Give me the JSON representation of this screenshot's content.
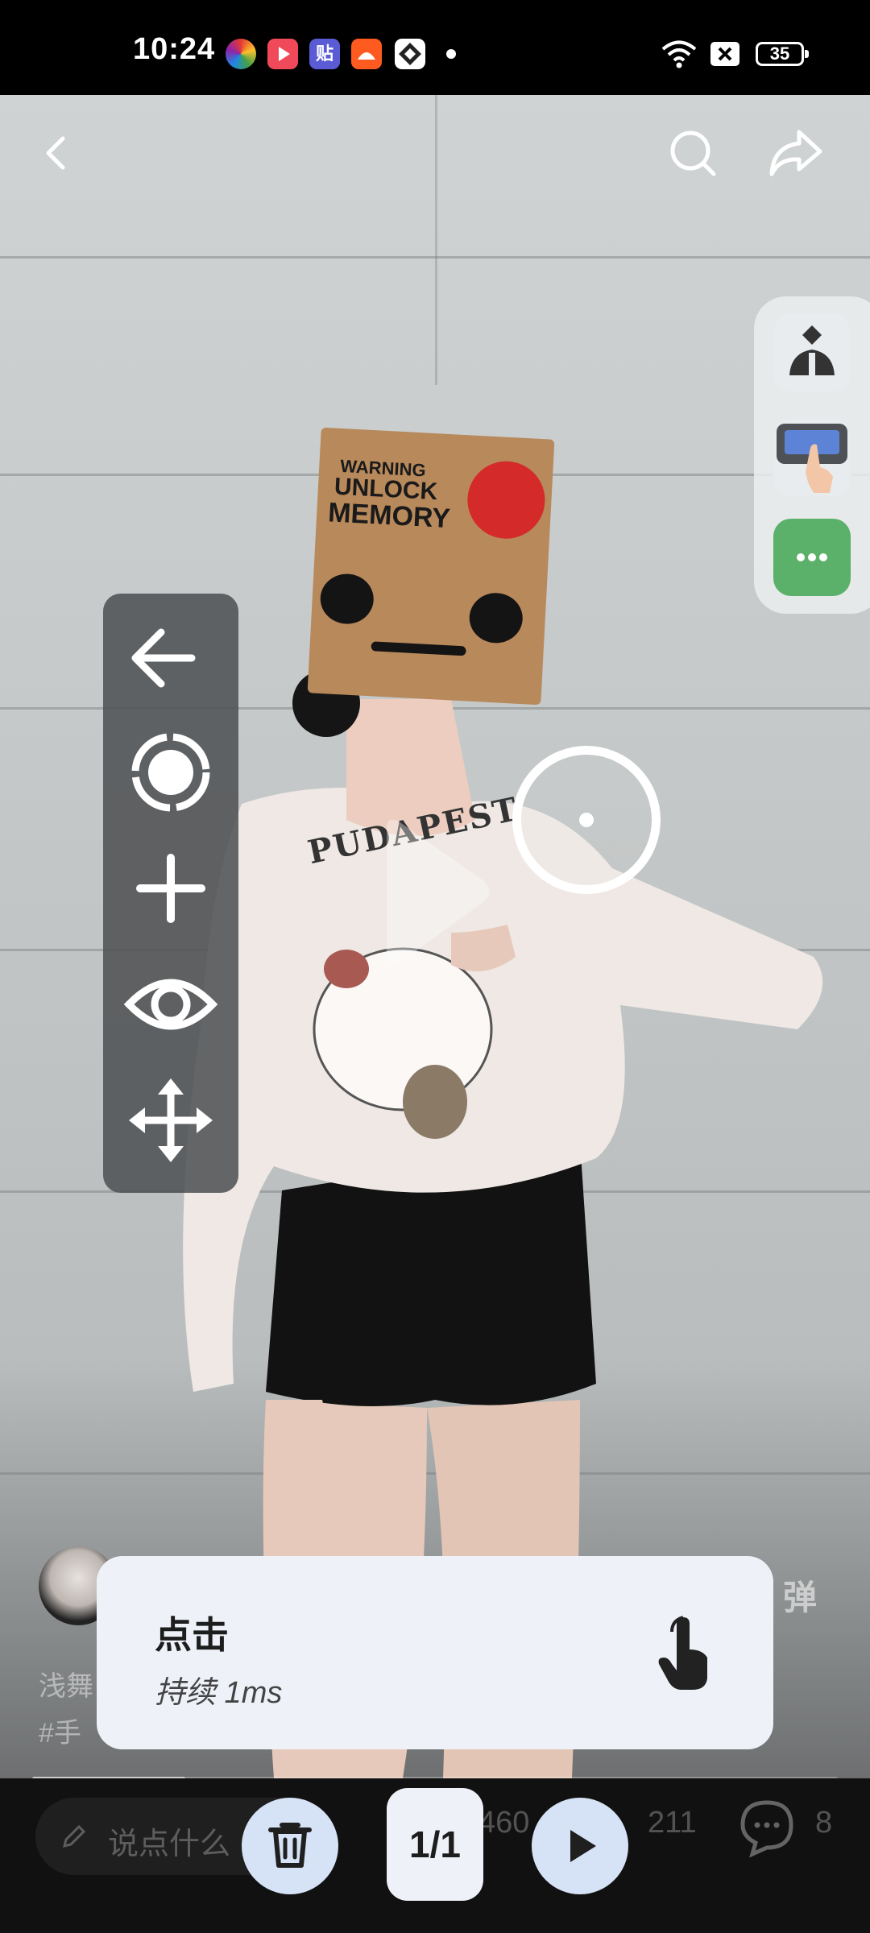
{
  "status_bar": {
    "time": "10:24",
    "battery": "35",
    "app_icons": [
      "colorful-app-icon",
      "video-app-icon",
      "tieba-app-icon",
      "taobao-app-icon",
      "puzzle-app-icon"
    ],
    "icons": [
      "wifi-icon",
      "x-box-icon",
      "battery-icon"
    ]
  },
  "top_bar": {
    "icons": [
      "back-icon",
      "search-icon",
      "share-icon"
    ]
  },
  "video_overlay": {
    "bag_text": [
      "WARNING",
      "UNLOCK",
      "MEMORY"
    ],
    "shirt_text": "PUDAPEST"
  },
  "right_panel": {
    "icons": [
      "robot-icon",
      "screen-touch-icon",
      "more-icon"
    ],
    "accent": "#5bb06a"
  },
  "tool_panel": {
    "icons": [
      "arrow-left-icon",
      "record-icon",
      "plus-icon",
      "eye-icon",
      "move-icon"
    ]
  },
  "bottom_info": {
    "author_prefix": "浅舞",
    "tag_prefix": "#手",
    "danmaku": "弹"
  },
  "toast": {
    "title": "点击",
    "subtitle": "持续 1ms",
    "icon": "tap-hand-icon"
  },
  "bottom_bar": {
    "comment_placeholder": "说点什么",
    "like_count": "460",
    "collect_count": "211",
    "comment_count": "8",
    "page_indicator": "1/1",
    "progress": 0.19
  }
}
